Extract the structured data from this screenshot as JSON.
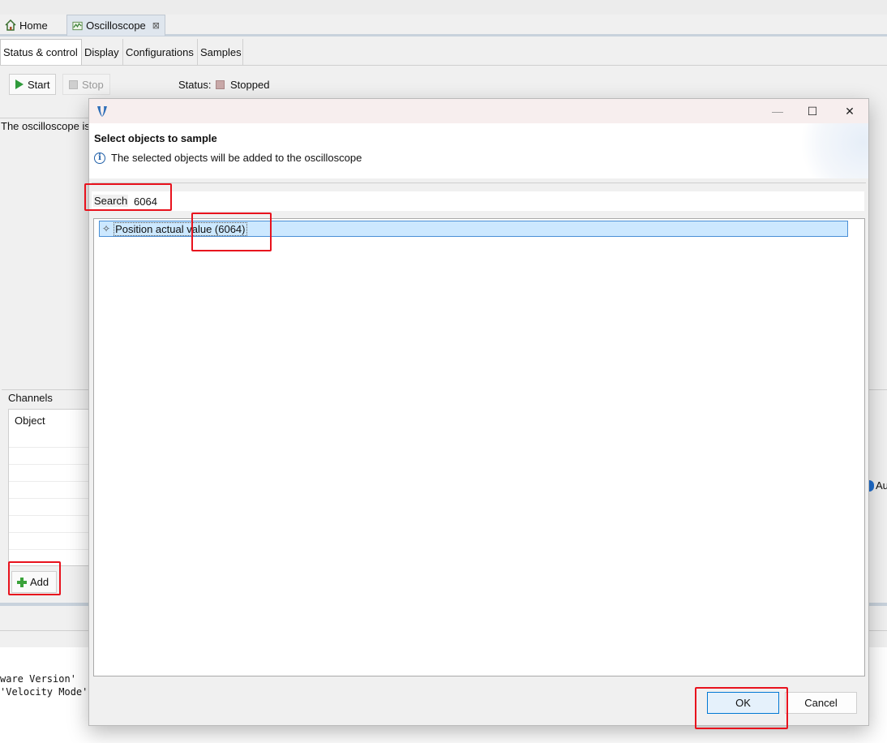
{
  "editor_tabs": [
    {
      "label": "Home",
      "icon": "home-icon"
    },
    {
      "label": "Oscilloscope",
      "icon": "oscilloscope-icon",
      "close": "⊠"
    }
  ],
  "subtabs": [
    "Status & control",
    "Display",
    "Configurations",
    "Samples"
  ],
  "controls": {
    "start_label": "Start",
    "stop_label": "Stop",
    "status_label": "Status:",
    "status_value": "Stopped"
  },
  "description_text": "The oscilloscope is",
  "channels": {
    "label": "Channels",
    "column_header": "Object",
    "add_label": "Add"
  },
  "right_fragment": "Au",
  "console_lines": [
    "ware Version'",
    "'Velocity Mode'"
  ],
  "dialog": {
    "header_title": "Select objects to sample",
    "header_message": "The selected objects will be added to the oscilloscope",
    "search_label": "Search",
    "search_value": "6064",
    "tree_items": [
      "Position actual value (6064)"
    ],
    "ok_label": "OK",
    "cancel_label": "Cancel",
    "window_controls": [
      "—",
      "☐",
      "✕"
    ]
  },
  "colors": {
    "accent": "#0078d4",
    "selection": "#cce8ff",
    "highlight": "#e8121d",
    "start_green": "#2e9a3a"
  }
}
